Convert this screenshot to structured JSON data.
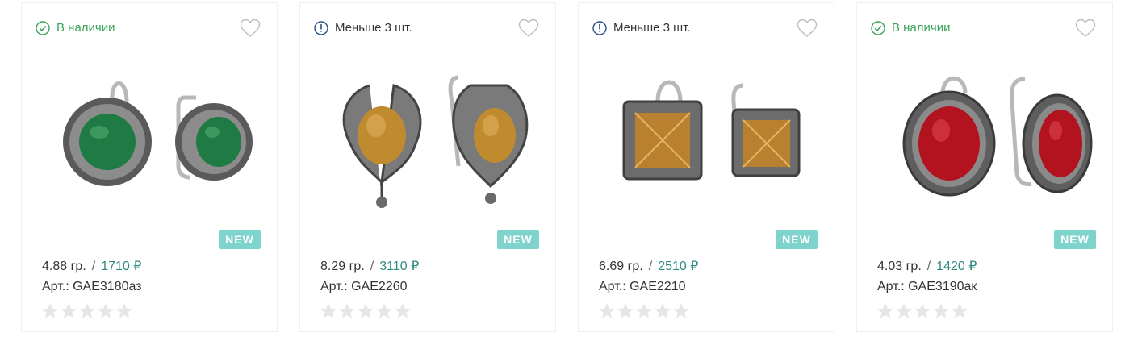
{
  "products": [
    {
      "status": "В наличии",
      "status_type": "in-stock",
      "weight": "4.88 гр.",
      "price": "1710 ₽",
      "article": "Арт.: GAE3180аз",
      "badge": "NEW",
      "stone_color": "#1f7a43",
      "rating": 0
    },
    {
      "status": "Меньше 3 шт.",
      "status_type": "low-stock",
      "weight": "8.29 гр.",
      "price": "3110 ₽",
      "article": "Арт.: GAE2260",
      "badge": "NEW",
      "stone_color": "#c08a2e",
      "rating": 0
    },
    {
      "status": "Меньше 3 шт.",
      "status_type": "low-stock",
      "weight": "6.69 гр.",
      "price": "2510 ₽",
      "article": "Арт.: GAE2210",
      "badge": "NEW",
      "stone_color": "#b9802f",
      "rating": 0
    },
    {
      "status": "В наличии",
      "status_type": "in-stock",
      "weight": "4.03 гр.",
      "price": "1420 ₽",
      "article": "Арт.: GAE3190ак",
      "badge": "NEW",
      "stone_color": "#b3131f",
      "rating": 0
    }
  ],
  "colors": {
    "in_stock": "#39a35b",
    "low_stock_icon": "#2a4f82",
    "price": "#2f8a80",
    "badge": "#7fd3cd",
    "star_empty": "#e6e6e6"
  },
  "icons": {
    "in_stock": "check-circle-icon",
    "low_stock": "info-circle-icon",
    "favorite": "heart-outline-icon",
    "rating": "star-icon"
  }
}
